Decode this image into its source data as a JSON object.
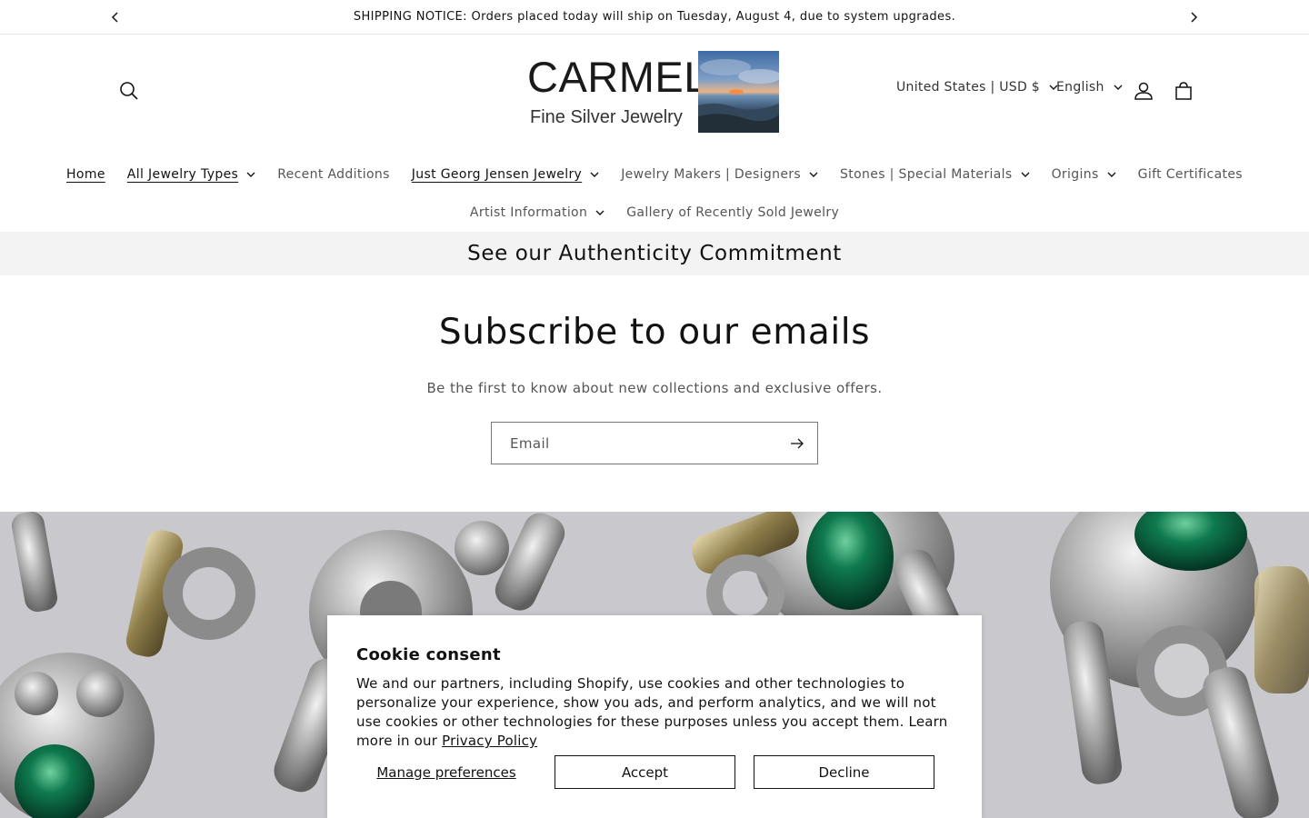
{
  "announcement": {
    "text": "SHIPPING NOTICE: Orders placed today will ship on Tuesday, August 4, due to system upgrades.",
    "prev_icon": "chevron-left-icon",
    "next_icon": "chevron-right-icon"
  },
  "header": {
    "logo_title": "CARMEL",
    "logo_subtitle": "Fine Silver Jewelry",
    "country_selector": "United States | USD $",
    "language_selector": "English",
    "icons": [
      "search-icon",
      "account-icon",
      "cart-icon"
    ]
  },
  "nav": {
    "row1": [
      {
        "label": "Home",
        "dropdown": false,
        "active": true
      },
      {
        "label": "All Jewelry Types",
        "dropdown": true,
        "active": true
      },
      {
        "label": "Recent Additions",
        "dropdown": false,
        "active": false
      },
      {
        "label": "Just Georg Jensen Jewelry",
        "dropdown": true,
        "active": true
      },
      {
        "label": "Jewelry Makers | Designers",
        "dropdown": true,
        "active": false
      },
      {
        "label": "Stones | Special Materials",
        "dropdown": true,
        "active": false
      },
      {
        "label": "Origins",
        "dropdown": true,
        "active": false
      },
      {
        "label": "Gift Certificates",
        "dropdown": false,
        "active": false
      }
    ],
    "row2": [
      {
        "label": "Artist Information",
        "dropdown": true,
        "active": false
      },
      {
        "label": "Gallery of Recently Sold Jewelry",
        "dropdown": false,
        "active": false
      }
    ]
  },
  "authenticity_banner": "See our Authenticity Commitment",
  "newsletter": {
    "title": "Subscribe to our emails",
    "subtitle": "Be the first to know about new collections and exclusive offers.",
    "email_placeholder": "Email",
    "submit_icon": "arrow-right-icon"
  },
  "cookie_consent": {
    "title": "Cookie consent",
    "body": "We and our partners, including Shopify, use cookies and other technologies to personalize your experience, show you ads, and perform analytics, and we will not use cookies or other technologies for these purposes unless you accept them. Learn more in our",
    "link_text": "Privacy Policy",
    "manage_label": "Manage preferences",
    "accept_label": "Accept",
    "decline_label": "Decline"
  },
  "colors": {
    "text": "#121212",
    "muted_text": "#555555",
    "banner_bg": "#f3f3f3",
    "border": "#e6e6e6"
  }
}
